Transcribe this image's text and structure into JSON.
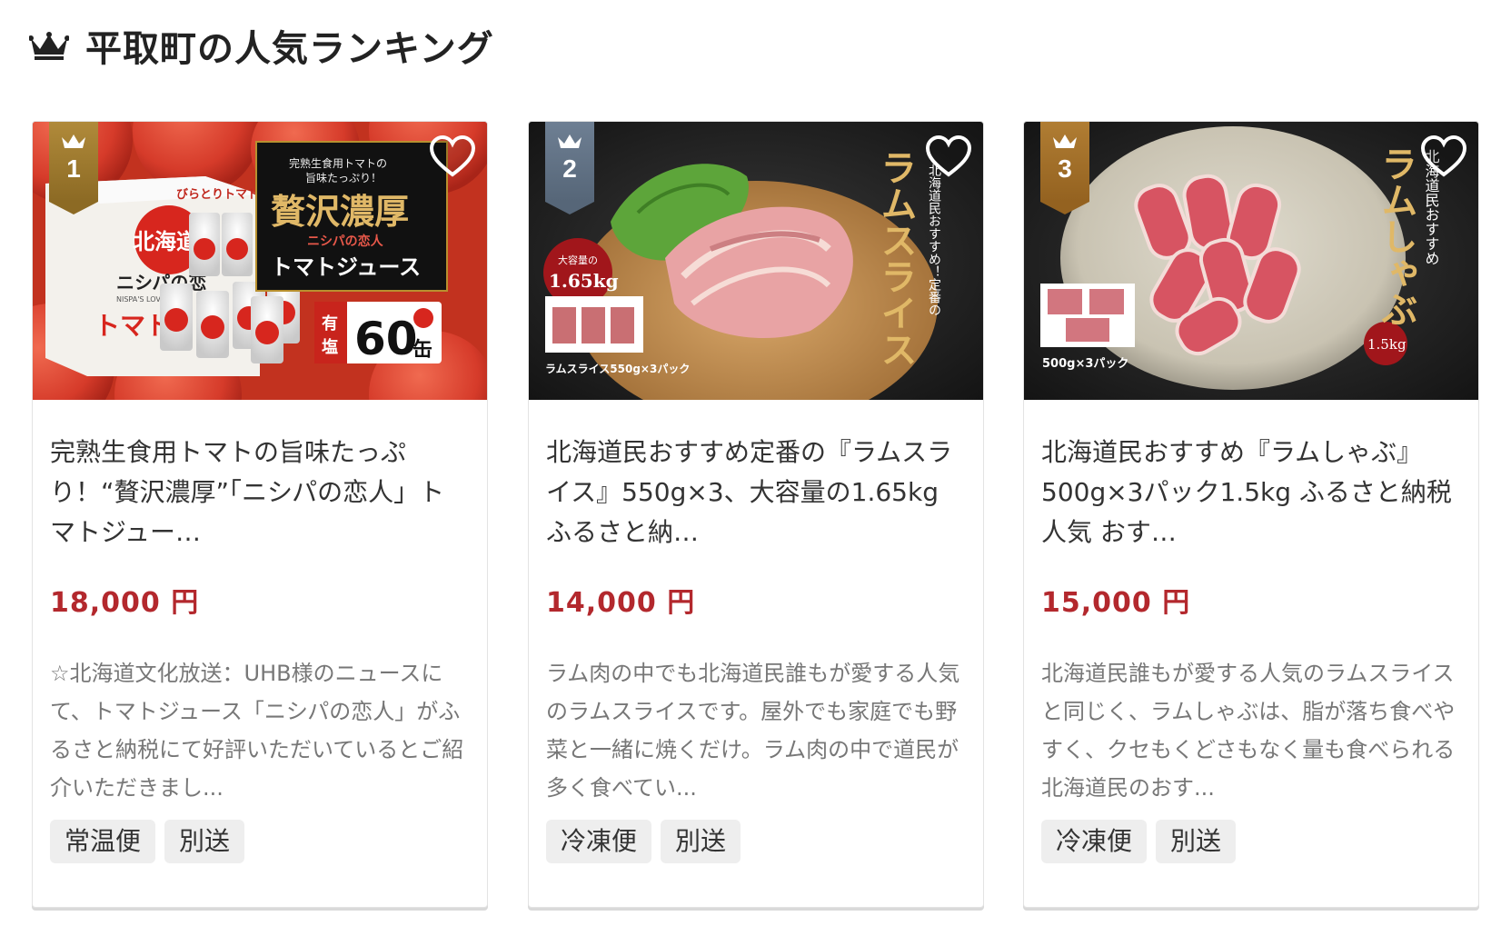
{
  "section": {
    "title": "平取町の人気ランキング",
    "icon": "crown-icon"
  },
  "cards": [
    {
      "rank": "1",
      "title": "完熟生食用トマトの旨味たっぷり！“贅沢濃厚”「ニシパの恋人」トマトジュー…",
      "price": "18,000 円",
      "description": "☆北海道文化放送：UHB様のニュースにて、トマトジュース「ニシパの恋人」がふるさと納税にて好評いただいているとご紹介いただきまし...",
      "tags": [
        "常温便",
        "別送"
      ],
      "image": {
        "line1": "完熟生食用トマトの",
        "line2": "旨味たっぷり！",
        "headline": "贅沢濃厚",
        "sub": "ニシパの恋人",
        "product": "トマトジュース",
        "salt": "有塩",
        "count": "60",
        "unit": "缶",
        "box_brand": "びらとりトマト",
        "box_region": "北海道",
        "box_name": "ニシパの恋",
        "box_en": "NISPA'S LOVER",
        "box_tomato": "トマト"
      }
    },
    {
      "rank": "2",
      "title": "北海道民おすすめ定番の『ラムスライス』550g×3、大容量の1.65kg ふるさと納…",
      "price": "14,000 円",
      "description": "ラム肉の中でも北海道民誰もが愛する人気のラムスライスです。屋外でも家庭でも野菜と一緒に焼くだけ。ラム肉の中で道民が多く食べてい...",
      "tags": [
        "冷凍便",
        "別送"
      ],
      "image": {
        "vertical_sub": "北海道民おすすめ！定番の",
        "vertical_main": "ラムスライス",
        "badge_top": "大容量の",
        "badge_main": "1.65kg",
        "caption": "ラムスライス550g×3パック"
      }
    },
    {
      "rank": "3",
      "title": "北海道民おすすめ『ラムしゃぶ』500g×3パック1.5kg ふるさと納税 人気 おす…",
      "price": "15,000 円",
      "description": "北海道民誰もが愛する人気のラムスライスと同じく、ラムしゃぶは、脂が落ち食べやすく、クセもくどさもなく量も食べられる北海道民のおす...",
      "tags": [
        "冷凍便",
        "別送"
      ],
      "image": {
        "vertical_sub": "北海道民おすすめ",
        "vertical_main": "ラムしゃぶ",
        "badge_main": "1.5kg",
        "caption": "500g×3パック"
      }
    }
  ]
}
